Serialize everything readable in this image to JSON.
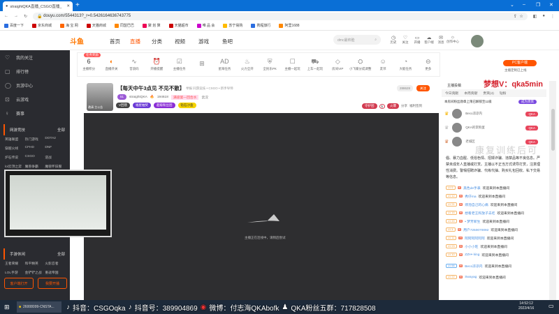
{
  "browser": {
    "tab_title": "straightQKA直播_CSGO直播_",
    "url": "douyu.com/5544313?_r=0.5426164636743775",
    "bookmarks": [
      "百度一下",
      "京东商城",
      "海 宝 网",
      "天猫商城",
      "同盟巴巴",
      "聚 划 算",
      "天猫超市",
      "唯 品 会",
      "苏宁易购",
      "携程旅行",
      "阿里1688"
    ]
  },
  "header": {
    "logo": "斗鱼",
    "nav": [
      "首页",
      "直播",
      "分类",
      "视频",
      "游戏",
      "鱼吧"
    ],
    "search_placeholder": "dmc最帅脸",
    "icons": [
      {
        "label": "历史",
        "icon": "clock-icon"
      },
      {
        "label": "关注",
        "icon": "heart-icon"
      },
      {
        "label": "开播",
        "icon": "camera-icon"
      },
      {
        "label": "客户端",
        "icon": "client-icon"
      },
      {
        "label": "消息",
        "icon": "message-icon"
      },
      {
        "label": "创作中心",
        "icon": "bulb-icon"
      }
    ]
  },
  "sidebar": {
    "items": [
      "我的关注",
      "排行榜",
      "页游中心",
      "云游戏",
      "赛事"
    ],
    "section1": {
      "title": "网游竞技",
      "more": "全部",
      "games": [
        "英雄联盟",
        "热门游戏",
        "DOTA2",
        "穿越火线",
        "CFHD",
        "DNF",
        "炉石传说",
        "CSGO",
        "逆战",
        "lol云顶之弈",
        "魔兽争霸",
        "魔兽怀旧服"
      ]
    },
    "section2": {
      "title": "手游休闲",
      "more": "全部",
      "games": [
        "王者荣耀",
        "和平精英",
        "火影忍者",
        "LOL手游",
        "金铲铲之战",
        "重返帝国"
      ]
    },
    "buttons": [
      "客户端打开",
      "我要开播"
    ]
  },
  "toolbar": {
    "badge": "任务奖励",
    "score_value": "6",
    "items": [
      "主播积分",
      "直播开关",
      "音浪码",
      "开播提醒",
      "主播任务",
      "",
      "星海任务",
      "火力全开",
      "全民乐PK",
      "主播一起玩",
      "上车一起玩",
      "房间VIP",
      "小飞碟分成调整",
      "友邻",
      "大能任务",
      "更多"
    ],
    "pc_button": "PC客户端",
    "pc_sub": "主播定制已上线"
  },
  "stream": {
    "title": "【每天中午3点见 不见不散】",
    "meta": "举报  同游竞技 • CSGO • 新手导师",
    "level": "51",
    "name": "straightQKA",
    "hot": "194618",
    "rank": "满级第一回合水",
    "location": "云汉",
    "chips": [
      "V回馈",
      "福星抽奖",
      "超级粉丝团",
      "钻石沙盒"
    ],
    "follow_count": "288628",
    "follow": "关注",
    "fire": "守护团",
    "fire_num": "1",
    "fire_suffix": "火爆",
    "share": "分享",
    "report": "福利签到",
    "avatar_tag": "邀请 主公告"
  },
  "video": {
    "status": "主播正在连线中，请稍后尝试"
  },
  "right": {
    "tab_label": "主播投稿",
    "tabs": [
      "今日贡献",
      "本周贡献",
      "贵宾(4)",
      "钻粉"
    ],
    "rank_notice": "本房间粉丝勋章上限已解锁至11级",
    "rank_btn": "成为贵宾",
    "rank": [
      {
        "name": "Beco凉凉内",
        "badge": "QKA"
      },
      {
        "name": "QKA的李狗蛋",
        "badge": "QKA"
      },
      {
        "name": "老城区",
        "badge": "QKA"
      }
    ],
    "notice": "倡、暴力血腥、低俗色情、招嫖诈骗、违禁品等不良信息。严禁未成年人直播或打赏。主播以不正当方式诱导打赏，注意理性消费。警惕招聘诈骗、代练代抽、购买礼包回收、私下交易等信息。",
    "messages": [
      {
        "lv": "LV 6",
        "user": "黑色de手表",
        "text": "欢迎来到本直播间"
      },
      {
        "lv": "LV 12",
        "user": "秀仔ma",
        "text": "欢迎来到本直播间"
      },
      {
        "lv": "LV 21",
        "user": "烦泡自己的心痛",
        "text": "欢迎来到本直播间"
      },
      {
        "lv": "LV 15",
        "user": "想看老王和放子去吃",
        "text": "欢迎来到本直播间"
      },
      {
        "lv": "LV 20",
        "user": "• 梦芳新生",
        "text": "欢迎来到本直播间"
      },
      {
        "lv": "LV 4",
        "user": "用户7250070092",
        "text": "欢迎来到本直播间"
      },
      {
        "lv": "LV 11",
        "user": "阿阿阿阿阿阿",
        "text": "欢迎来到本直播间"
      },
      {
        "lv": "LV 23",
        "user": "小小小旺",
        "text": "欢迎来到本直播间"
      },
      {
        "lv": "LV 10",
        "user": "ZZH• king",
        "text": "欢迎来到本直播间"
      },
      {
        "lv": "LV 66",
        "user": "Beco凉凉内",
        "text": "欢迎来到本直播间"
      },
      {
        "lv": "LV 22",
        "user": "Swayag",
        "text": "欢迎来到本直播间"
      }
    ]
  },
  "overlay": {
    "vtext": "梦想V：qka5min",
    "watermark": "康复训练后可",
    "douyin": "抖音：CSGOqka",
    "douyin_id": "抖音号：389904869",
    "weibo": "微博：付志海QKAbofk",
    "fans": "QKA粉丝五群：717828508"
  },
  "taskbar": {
    "app": "26008099-CNSTA...",
    "time": "14:52:12",
    "date": "2022/4/16"
  }
}
